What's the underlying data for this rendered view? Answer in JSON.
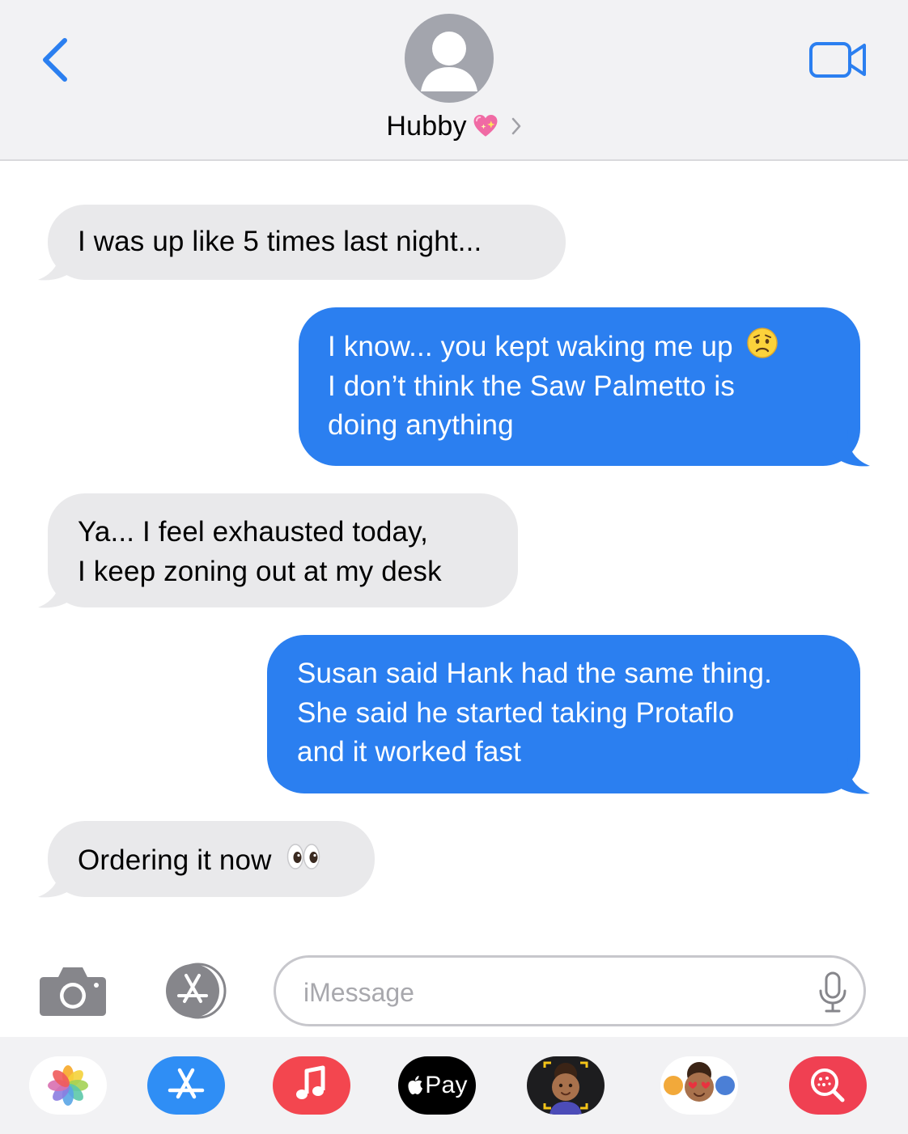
{
  "header": {
    "contact_name": "Hubby",
    "back_icon": "chevron-left-icon",
    "video_icon": "video-camera-icon",
    "avatar_icon": "person-silhouette-icon",
    "name_emoji": "sparkling-heart-emoji",
    "accent_color": "#2b7ff0"
  },
  "messages": [
    {
      "direction": "incoming",
      "lines": [
        "I was up like 5 times last night..."
      ]
    },
    {
      "direction": "outgoing",
      "lines": [
        "I know... you kept waking me up",
        "I don’t think the Saw Palmetto is",
        "doing anything"
      ],
      "emoji": "worried-face-emoji"
    },
    {
      "direction": "incoming",
      "lines": [
        "Ya... I feel exhausted today,",
        "I keep zoning out at my desk"
      ]
    },
    {
      "direction": "outgoing",
      "lines": [
        "Susan said Hank had the same thing.",
        "She said he started taking Protaflo",
        "and it worked fast"
      ]
    },
    {
      "direction": "incoming",
      "lines": [
        "Ordering it now"
      ],
      "emoji": "eyes-emoji"
    }
  ],
  "composer": {
    "placeholder": "iMessage",
    "camera_icon": "camera-icon",
    "apps_icon": "app-store-icon",
    "mic_icon": "microphone-icon"
  },
  "app_drawer": {
    "apps": [
      {
        "name": "photos-app-icon"
      },
      {
        "name": "app-store-app-icon"
      },
      {
        "name": "music-app-icon"
      },
      {
        "name": "apple-pay-app-icon",
        "label": "Pay"
      },
      {
        "name": "memoji-app-icon"
      },
      {
        "name": "memoji-stickers-app-icon"
      },
      {
        "name": "web-image-search-app-icon"
      }
    ]
  }
}
